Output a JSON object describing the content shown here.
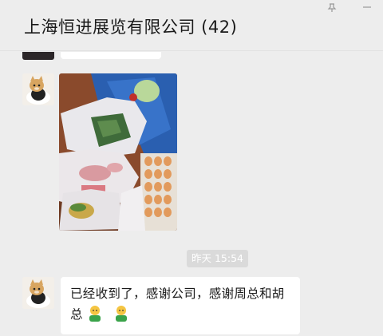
{
  "header": {
    "title": "上海恒进展览有限公司 (42)",
    "icons": [
      "pin-icon",
      "minimize-icon"
    ]
  },
  "messages": [
    {
      "type": "image",
      "sender_avatar": "cat-avatar",
      "content": "photo-of-groceries"
    },
    {
      "type": "timestamp",
      "text": "昨天 15:54"
    },
    {
      "type": "text",
      "sender_avatar": "cat-avatar",
      "text": "已经收到了，感谢公司，感谢周总和胡总",
      "emojis": [
        "person-emoji",
        "person-emoji"
      ]
    }
  ],
  "colors": {
    "background": "#ededed",
    "bubble": "#ffffff",
    "timestamp_bg": "#dadada"
  }
}
